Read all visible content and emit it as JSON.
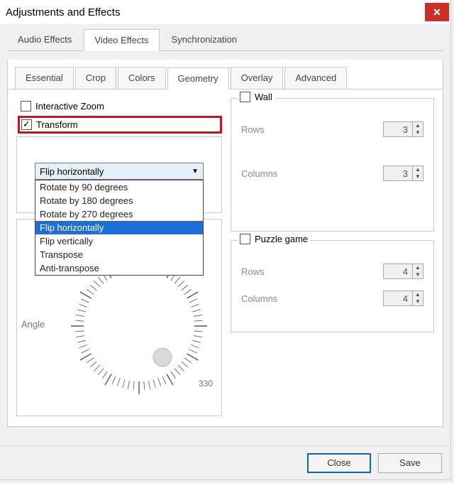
{
  "window": {
    "title": "Adjustments and Effects"
  },
  "primaryTabs": {
    "items": [
      "Audio Effects",
      "Video Effects",
      "Synchronization"
    ],
    "active": 1
  },
  "subTabs": {
    "items": [
      "Essential",
      "Crop",
      "Colors",
      "Geometry",
      "Overlay",
      "Advanced"
    ],
    "active": 3
  },
  "left": {
    "interactiveZoom": {
      "label": "Interactive Zoom",
      "checked": false
    },
    "transform": {
      "label": "Transform",
      "checked": true
    },
    "combo": {
      "selected": "Flip horizontally",
      "options": [
        "Rotate by 90 degrees",
        "Rotate by 180 degrees",
        "Rotate by 270 degrees",
        "Flip horizontally",
        "Flip vertically",
        "Transpose",
        "Anti-transpose"
      ],
      "highlightIndex": 3
    },
    "angleLabel": "Angle",
    "dialMark": "330"
  },
  "wall": {
    "title": "Wall",
    "checked": false,
    "rowsLabel": "Rows",
    "rows": 3,
    "colsLabel": "Columns",
    "cols": 3
  },
  "puzzle": {
    "title": "Puzzle game",
    "checked": false,
    "rowsLabel": "Rows",
    "rows": 4,
    "colsLabel": "Columns",
    "cols": 4
  },
  "footer": {
    "close": "Close",
    "save": "Save"
  }
}
